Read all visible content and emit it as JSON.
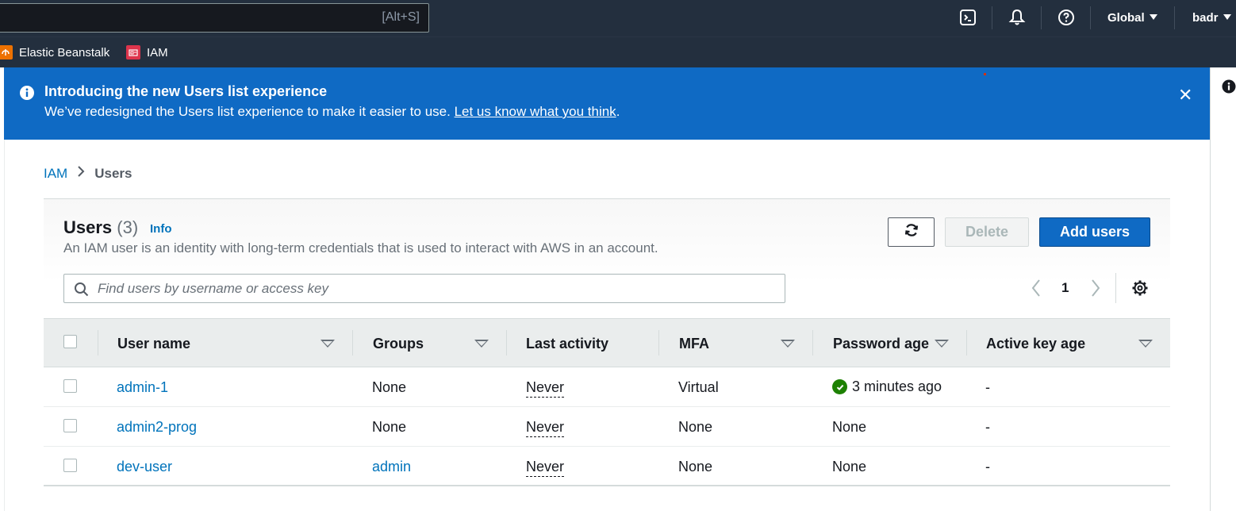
{
  "topnav": {
    "search_hint": "[Alt+S]",
    "icons": [
      "cloudshell-icon",
      "bell-icon",
      "help-icon"
    ],
    "region": "Global",
    "user": "badr"
  },
  "favorites": [
    {
      "label": "Elastic Beanstalk",
      "icon": "elastic-beanstalk-icon",
      "color": "#ed7100"
    },
    {
      "label": "IAM",
      "icon": "iam-icon",
      "color": "#dd344c"
    }
  ],
  "banner": {
    "title": "Introducing the new Users list experience",
    "text": "We’ve redesigned the Users list experience to make it easier to use. ",
    "link": "Let us know what you think",
    "suffix": ".",
    "color": "#0f6ac4"
  },
  "breadcrumb": {
    "root": "IAM",
    "current": "Users"
  },
  "header": {
    "title": "Users",
    "count": "(3)",
    "info": "Info",
    "description": "An IAM user is an identity with long-term credentials that is used to interact with AWS in an account."
  },
  "actions": {
    "delete": "Delete",
    "add": "Add users"
  },
  "search": {
    "placeholder": "Find users by username or access key",
    "value": ""
  },
  "pagination": {
    "page": "1"
  },
  "columns": [
    "User name",
    "Groups",
    "Last activity",
    "MFA",
    "Password age",
    "Active key age"
  ],
  "rows": [
    {
      "user": "admin-1",
      "groups": "None",
      "last_activity": "Never",
      "mfa": "Virtual",
      "password_age": "3 minutes ago",
      "key_age": "-"
    },
    {
      "user": "admin2-prog",
      "groups": "None",
      "last_activity": "Never",
      "mfa": "None",
      "password_age": "None",
      "key_age": "-"
    },
    {
      "user": "dev-user",
      "groups": "admin",
      "last_activity": "Never",
      "mfa": "None",
      "password_age": "None",
      "key_age": "-"
    }
  ],
  "colors": {
    "nav": "#232f3e",
    "link": "#0073bb",
    "primary": "#0f6ac4",
    "success": "#1d8102"
  }
}
